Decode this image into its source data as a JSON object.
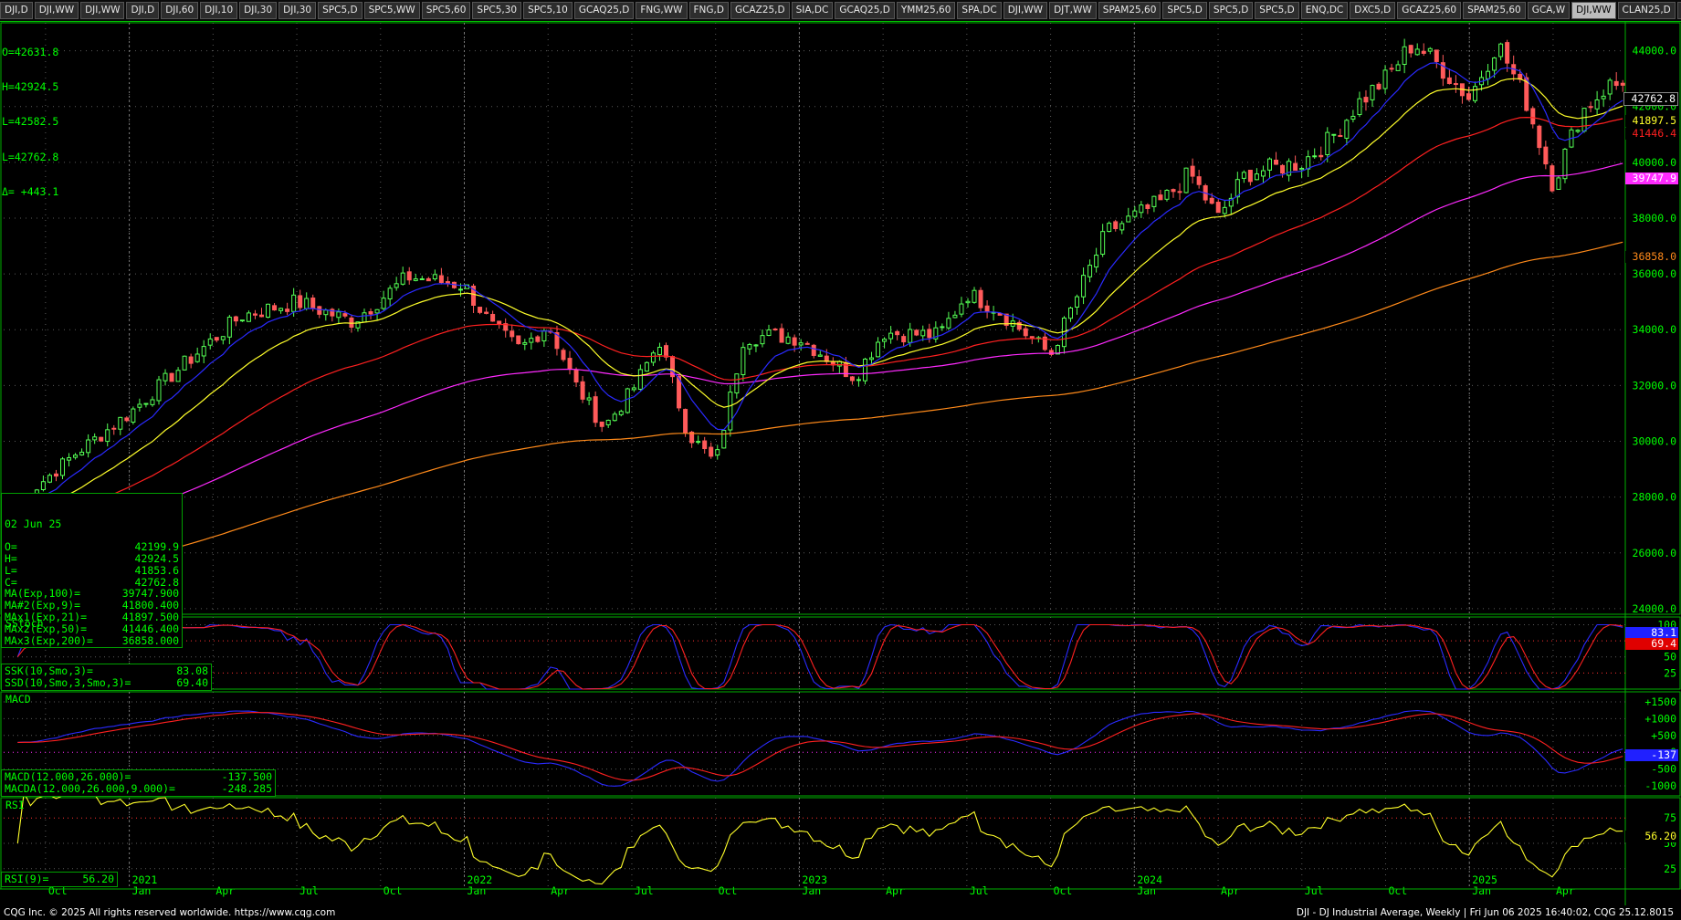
{
  "tabs": [
    "DJI,D",
    "DJI,WW",
    "DJI,WW",
    "DJI,D",
    "DJI,60",
    "DJI,10",
    "DJI,30",
    "DJI,30",
    "SPC5,D",
    "SPC5,WW",
    "SPC5,60",
    "SPC5,30",
    "SPC5,10",
    "GCAQ25,D",
    "FNG,WW",
    "FNG,D",
    "GCAZ25,D",
    "SIA,DC",
    "GCAQ25,D",
    "YMM25,60",
    "SPA,DC",
    "DJI,WW",
    "DJT,WW",
    "SPAM25,60",
    "SPC5,D",
    "SPC5,D",
    "SPC5,D",
    "ENQ,DC",
    "DXC5,D",
    "GCAZ25,60",
    "SPAM25,60",
    "GCA,W",
    "DJI,WW",
    "CLAN25,D",
    "+"
  ],
  "active_tab_index": 32,
  "colors": {
    "bg": "#000000",
    "text": "#00ff00",
    "up": "#55ff55",
    "down": "#ff5a5a",
    "ema9": "#2a2aff",
    "ema21": "#ffff2a",
    "ema50": "#ff2020",
    "ema100": "#ff2aff",
    "ema200": "#ff8a1a",
    "grid": "#5a5a5a",
    "ref": "#ff3030"
  },
  "top_info": {
    "o": "O=42631.8",
    "h": "H=42924.5",
    "l": "L=42582.5",
    "l2": "L=42762.8",
    "delta": "Δ= +443.1"
  },
  "price_info": {
    "date": "02 Jun 25",
    "rows": [
      [
        "O=",
        "42199.9"
      ],
      [
        "H=",
        "42924.5"
      ],
      [
        "L=",
        "41853.6"
      ],
      [
        "C=",
        "42762.8"
      ],
      [
        "MA(Exp,100)=",
        "39747.900"
      ],
      [
        "MA#2(Exp,9)=",
        "41800.400"
      ],
      [
        "MAx1(Exp,21)=",
        "41897.500"
      ],
      [
        "MAx2(Exp,50)=",
        "41446.400"
      ],
      [
        "MAx3(Exp,200)=",
        "36858.000"
      ]
    ]
  },
  "stoch_info": {
    "title": "SStoch",
    "rows": [
      [
        "SSK(10,Smo,3)=",
        "83.08"
      ],
      [
        "SSD(10,Smo,3,Smo,3)=",
        "69.40"
      ]
    ]
  },
  "macd_info": {
    "title": "MACD",
    "rows": [
      [
        "MACD(12.000,26.000)=",
        "-137.500"
      ],
      [
        "MACDA(12.000,26.000,9.000)=",
        "-248.285"
      ]
    ]
  },
  "rsi_info": {
    "title": "RSI",
    "rows": [
      [
        "RSI(9)=",
        "56.20"
      ]
    ]
  },
  "value_labels": {
    "close": "42762.8",
    "ema21": "41897.5",
    "ema50": "41446.4",
    "ema100": "39747.9",
    "ema200": "36858.0",
    "ssk": "83.1",
    "ssd": "69.4",
    "macd": "-137",
    "rsi": "56.20"
  },
  "footer": {
    "left": "CQG Inc. © 2025 All rights reserved worldwide. https://www.cqg.com",
    "right": "DJI - DJ Industrial Average, Weekly | Fri Jun 06 2025 16:40:02, CQG 25.12.8015"
  },
  "chart_data": {
    "type": "candlestick",
    "instrument": "DJI - DJ Industrial Average, Weekly",
    "price_axis": {
      "ticks": [
        24000,
        26000,
        28000,
        30000,
        32000,
        34000,
        36000,
        38000,
        40000,
        42000,
        44000
      ],
      "range": [
        23800,
        45000
      ]
    },
    "time_axis": {
      "months": [
        "Oct",
        "Jan",
        "Apr",
        "Jul",
        "Oct",
        "Jan",
        "Apr",
        "Jul",
        "Oct",
        "Jan",
        "Apr",
        "Jul",
        "Oct",
        "Jan",
        "Apr",
        "Jul",
        "Oct",
        "Jan",
        "Apr"
      ],
      "years": [
        "2021",
        "2022",
        "2023",
        "2024",
        "2025"
      ]
    },
    "anchors": [
      [
        "2020-09",
        27800
      ],
      [
        "2020-11",
        29500
      ],
      [
        "2021-01",
        31000
      ],
      [
        "2021-03",
        32800
      ],
      [
        "2021-05",
        34500
      ],
      [
        "2021-07",
        35000
      ],
      [
        "2021-09",
        34300
      ],
      [
        "2021-11",
        35900
      ],
      [
        "2022-01",
        35600
      ],
      [
        "2022-02",
        34100
      ],
      [
        "2022-03",
        33300
      ],
      [
        "2022-04",
        34200
      ],
      [
        "2022-05",
        32000
      ],
      [
        "2022-06",
        30500
      ],
      [
        "2022-07",
        31800
      ],
      [
        "2022-08",
        33600
      ],
      [
        "2022-09",
        30300
      ],
      [
        "2022-10",
        29200
      ],
      [
        "2022-11",
        33700
      ],
      [
        "2022-12",
        33800
      ],
      [
        "2023-01",
        33700
      ],
      [
        "2023-03",
        32300
      ],
      [
        "2023-04",
        33900
      ],
      [
        "2023-06",
        33800
      ],
      [
        "2023-07",
        35300
      ],
      [
        "2023-08",
        34800
      ],
      [
        "2023-10",
        33100
      ],
      [
        "2023-11",
        35300
      ],
      [
        "2023-12",
        37500
      ],
      [
        "2024-02",
        38600
      ],
      [
        "2024-03",
        39600
      ],
      [
        "2024-04",
        38000
      ],
      [
        "2024-05",
        39600
      ],
      [
        "2024-07",
        40000
      ],
      [
        "2024-08",
        40800
      ],
      [
        "2024-09",
        42100
      ],
      [
        "2024-10",
        43000
      ],
      [
        "2024-11",
        44300
      ],
      [
        "2024-12",
        43400
      ],
      [
        "2025-01",
        42300
      ],
      [
        "2025-02",
        44300
      ],
      [
        "2025-03",
        42300
      ],
      [
        "2025-04",
        39200
      ],
      [
        "2025-05",
        41800
      ],
      [
        "2025-06",
        42762.8
      ]
    ],
    "moving_averages": {
      "ema9": 41800.4,
      "ema21": 41897.5,
      "ema50": 41446.4,
      "ema100": 39747.9,
      "ema200": 36858.0
    },
    "stochastic": {
      "ticks": [
        25,
        50,
        75,
        100
      ],
      "ssk": 83.08,
      "ssd": 69.4
    },
    "macd": {
      "ticks": [
        -1000,
        -500,
        0,
        500,
        1000,
        1500
      ],
      "macd": -137.5,
      "signal": -248.285
    },
    "rsi": {
      "ticks": [
        25,
        50,
        75
      ],
      "rsi": 56.2
    }
  }
}
